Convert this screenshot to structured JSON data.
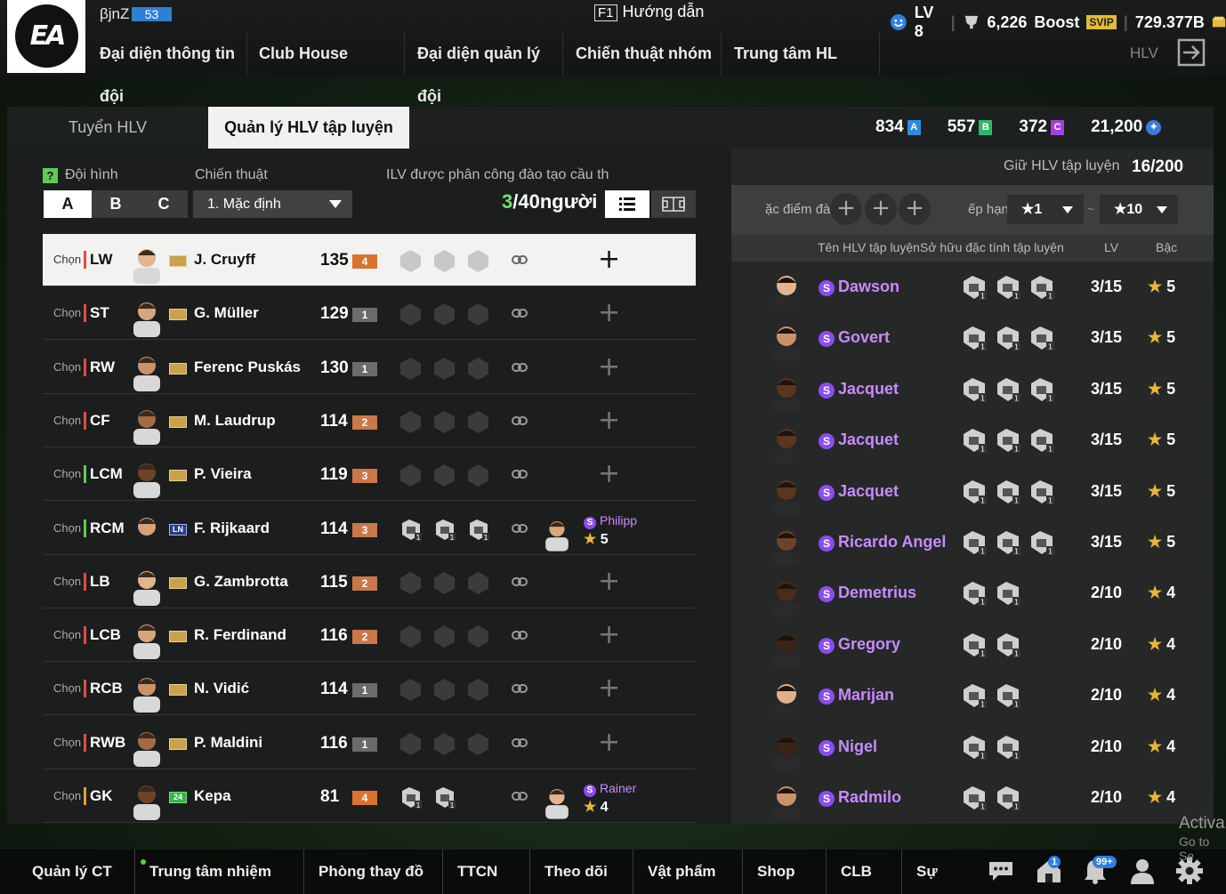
{
  "header": {
    "username": "βjnZ",
    "user_level": "53",
    "guide_key": "F1",
    "guide_label": "Hướng dẫn",
    "lv": "LV 8",
    "trophy": "6,226",
    "boost": "Boost",
    "svip": "SVIP",
    "bp": "729.377B",
    "coach_label": "HLV"
  },
  "nav": [
    "Đại diện thông tin đội",
    "Club House",
    "Đại diện quản lý đội",
    "Chiến thuật nhóm",
    "Trung tâm HL"
  ],
  "tabs": {
    "recruit": "Tuyển HLV",
    "manage": "Quản lý HLV tập luyện"
  },
  "currencies": [
    {
      "value": "834",
      "code": "A",
      "color": "#2e8be0"
    },
    {
      "value": "557",
      "code": "B",
      "color": "#2fb86a"
    },
    {
      "value": "372",
      "code": "C",
      "color": "#a53fe0"
    },
    {
      "value": "21,200",
      "code": "✦",
      "color": "#3a7be0"
    }
  ],
  "left": {
    "squad_label": "Đội hình",
    "help": "?",
    "squads": [
      "A",
      "B",
      "C"
    ],
    "tactic_label": "Chiến thuật",
    "tactic_value": "1. Mặc định",
    "assign_label": "ILV được phân công đào tạo cầu th",
    "count_now": "3",
    "count_rest": "/40người"
  },
  "players": [
    {
      "chon": "Chọn",
      "pos": "LW",
      "type": "att",
      "card": "ICON",
      "name": "J. Cruyff",
      "ovr": "135",
      "lvl": "4",
      "lvlc": "#d9732e",
      "sel": true,
      "coach": null
    },
    {
      "chon": "Chọn",
      "pos": "ST",
      "type": "att",
      "card": "ICON",
      "name": "G. Müller",
      "ovr": "129",
      "lvl": "1",
      "lvlc": "#6a6c6b",
      "coach": null
    },
    {
      "chon": "Chọn",
      "pos": "RW",
      "type": "att",
      "card": "ICON",
      "name": "Ferenc Puskás",
      "ovr": "130",
      "lvl": "1",
      "lvlc": "#6a6c6b",
      "coach": null
    },
    {
      "chon": "Chọn",
      "pos": "CF",
      "type": "att",
      "card": "ICON",
      "name": "M. Laudrup",
      "ovr": "114",
      "lvl": "2",
      "lvlc": "#c9784a",
      "coach": null
    },
    {
      "chon": "Chọn",
      "pos": "LCM",
      "type": "mid",
      "card": "ICON",
      "name": "P. Vieira",
      "ovr": "119",
      "lvl": "3",
      "lvlc": "#c9784a",
      "coach": null
    },
    {
      "chon": "Chọn",
      "pos": "RCM",
      "type": "mid",
      "card": "LN",
      "name": "F. Rijkaard",
      "ovr": "114",
      "lvl": "3",
      "lvlc": "#c9784a",
      "coach": {
        "name": "Philipp",
        "stars": "5"
      }
    },
    {
      "chon": "Chọn",
      "pos": "LB",
      "type": "def",
      "card": "ICON",
      "name": "G. Zambrotta",
      "ovr": "115",
      "lvl": "2",
      "lvlc": "#c9784a",
      "coach": null
    },
    {
      "chon": "Chọn",
      "pos": "LCB",
      "type": "def",
      "card": "ICON",
      "name": "R. Ferdinand",
      "ovr": "116",
      "lvl": "2",
      "lvlc": "#c9784a",
      "coach": null
    },
    {
      "chon": "Chọn",
      "pos": "RCB",
      "type": "def",
      "card": "ICON",
      "name": "N. Vidić",
      "ovr": "114",
      "lvl": "1",
      "lvlc": "#6a6c6b",
      "coach": null
    },
    {
      "chon": "Chọn",
      "pos": "RWB",
      "type": "def",
      "card": "ICON",
      "name": "P. Maldini",
      "ovr": "116",
      "lvl": "1",
      "lvlc": "#6a6c6b",
      "coach": null
    },
    {
      "chon": "Chọn",
      "pos": "GK",
      "type": "gk",
      "card": "24",
      "name": "Kepa",
      "ovr": "81",
      "lvl": "4",
      "lvlc": "#d9732e",
      "coach": {
        "name": "Rainer",
        "stars": "4"
      }
    }
  ],
  "right": {
    "holding_label": "Giữ HLV tập luyện",
    "holding_value": "16/200",
    "filter_label": "ặc điểm đà",
    "rank_label": "ếp hạn",
    "rank_from": "★1",
    "tilde": "~",
    "rank_to": "★10",
    "col_name": "Tên HLV tập luyện",
    "col_traits": "Sở hữu đặc tính tập luyện",
    "col_lv": "LV",
    "col_rank": "Bậc"
  },
  "coaches": [
    {
      "name": "Dawson",
      "traits": 3,
      "lv": "3/15",
      "star": "5"
    },
    {
      "name": "Govert",
      "traits": 3,
      "lv": "3/15",
      "star": "5"
    },
    {
      "name": "Jacquet",
      "traits": 3,
      "lv": "3/15",
      "star": "5"
    },
    {
      "name": "Jacquet",
      "traits": 3,
      "lv": "3/15",
      "star": "5"
    },
    {
      "name": "Jacquet",
      "traits": 3,
      "lv": "3/15",
      "star": "5"
    },
    {
      "name": "Ricardo Angel",
      "traits": 3,
      "lv": "3/15",
      "star": "5"
    },
    {
      "name": "Demetrius",
      "traits": 2,
      "lv": "2/10",
      "star": "4"
    },
    {
      "name": "Gregory",
      "traits": 2,
      "lv": "2/10",
      "star": "4"
    },
    {
      "name": "Marijan",
      "traits": 2,
      "lv": "2/10",
      "star": "4"
    },
    {
      "name": "Nigel",
      "traits": 2,
      "lv": "2/10",
      "star": "4"
    },
    {
      "name": "Radmilo",
      "traits": 2,
      "lv": "2/10",
      "star": "4"
    }
  ],
  "bottom": {
    "items": [
      "Quản lý CT",
      "Trung tâm nhiệm vụ",
      "Phòng thay đồ",
      "TTCN",
      "Theo dõi",
      "Vật phẩm",
      "Shop",
      "CLB",
      "Sự kiện"
    ],
    "badge_home": "1",
    "badge_bell": "99+"
  },
  "watermark": {
    "line1": "Activa",
    "line2": "Go to Se"
  }
}
